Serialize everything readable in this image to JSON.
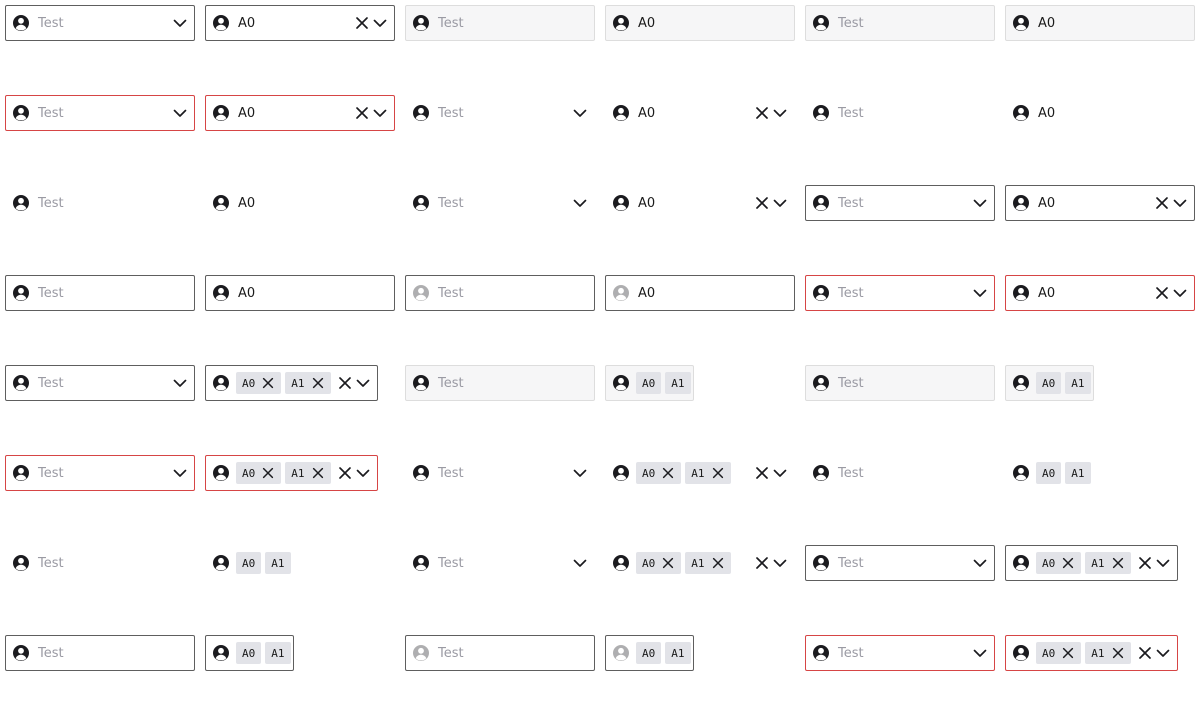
{
  "placeholder": "Test",
  "value_single": "A0",
  "tag_values": [
    "A0",
    "A1"
  ],
  "colors": {
    "border": "#5e5e5e",
    "error_border": "#d64545",
    "disabled_bg": "#f6f6f7",
    "tag_bg": "#e2e3e8",
    "placeholder_text": "#9a9aa3"
  },
  "icons": {
    "prefix": "person-circle-icon",
    "clear": "close-icon",
    "tag_remove": "close-icon",
    "dropdown": "chevron-down-icon"
  }
}
